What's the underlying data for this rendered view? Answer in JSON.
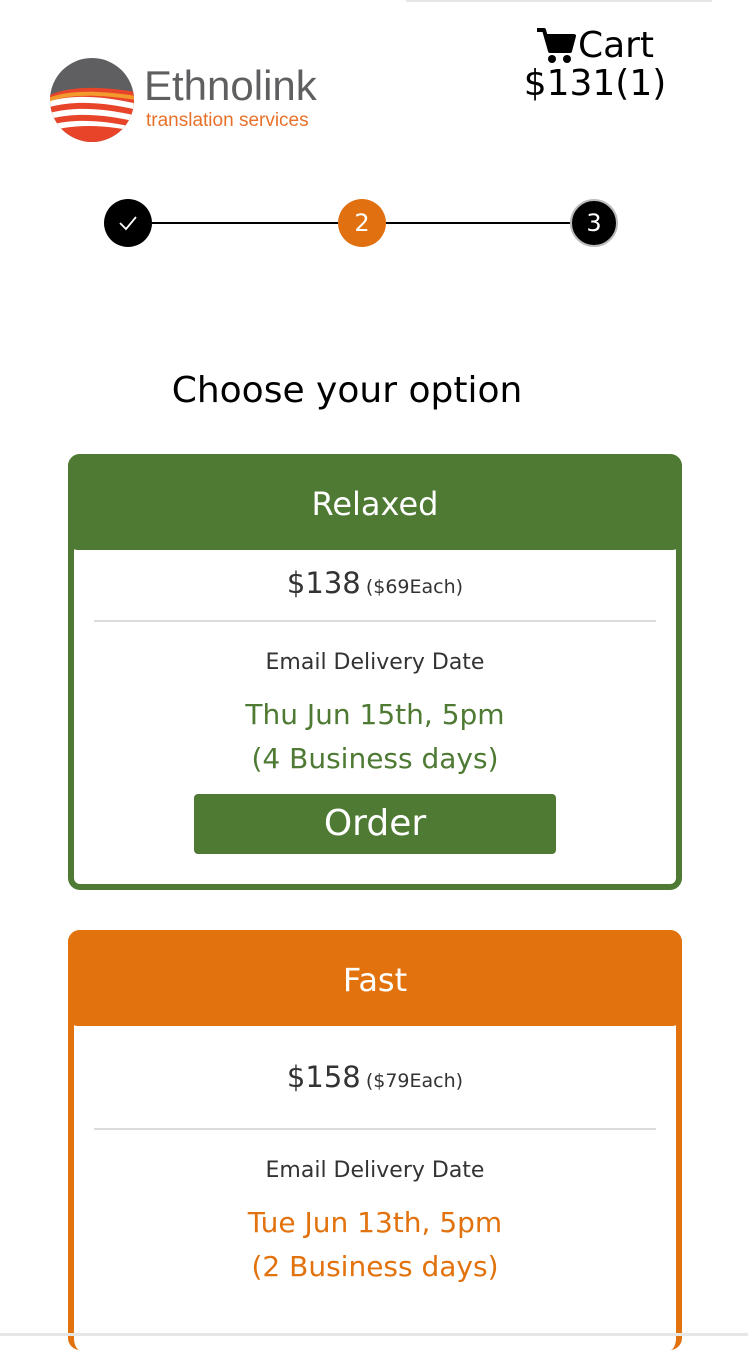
{
  "logo": {
    "name": "Ethnolink",
    "tagline": "translation services"
  },
  "cart": {
    "label": "Cart",
    "total": "$131(1)"
  },
  "stepper": {
    "steps": [
      {
        "label": "",
        "state": "complete"
      },
      {
        "label": "2",
        "state": "current"
      },
      {
        "label": "3",
        "state": "upcoming"
      }
    ]
  },
  "heading": "Choose your option",
  "options": [
    {
      "name": "Relaxed",
      "price": "$138",
      "each": "($69Each)",
      "delivery_label": "Email Delivery Date",
      "date": "Thu Jun 15th, 5pm",
      "days": "(4 Business days)",
      "order_label": "Order",
      "color": "#4e7a34"
    },
    {
      "name": "Fast",
      "price": "$158",
      "each": "($79Each)",
      "delivery_label": "Email Delivery Date",
      "date": "Tue Jun 13th, 5pm",
      "days": "(2 Business days)",
      "color": "#e2720d"
    }
  ],
  "colors": {
    "accent_orange": "#e2720d",
    "accent_green": "#4e7a34"
  }
}
